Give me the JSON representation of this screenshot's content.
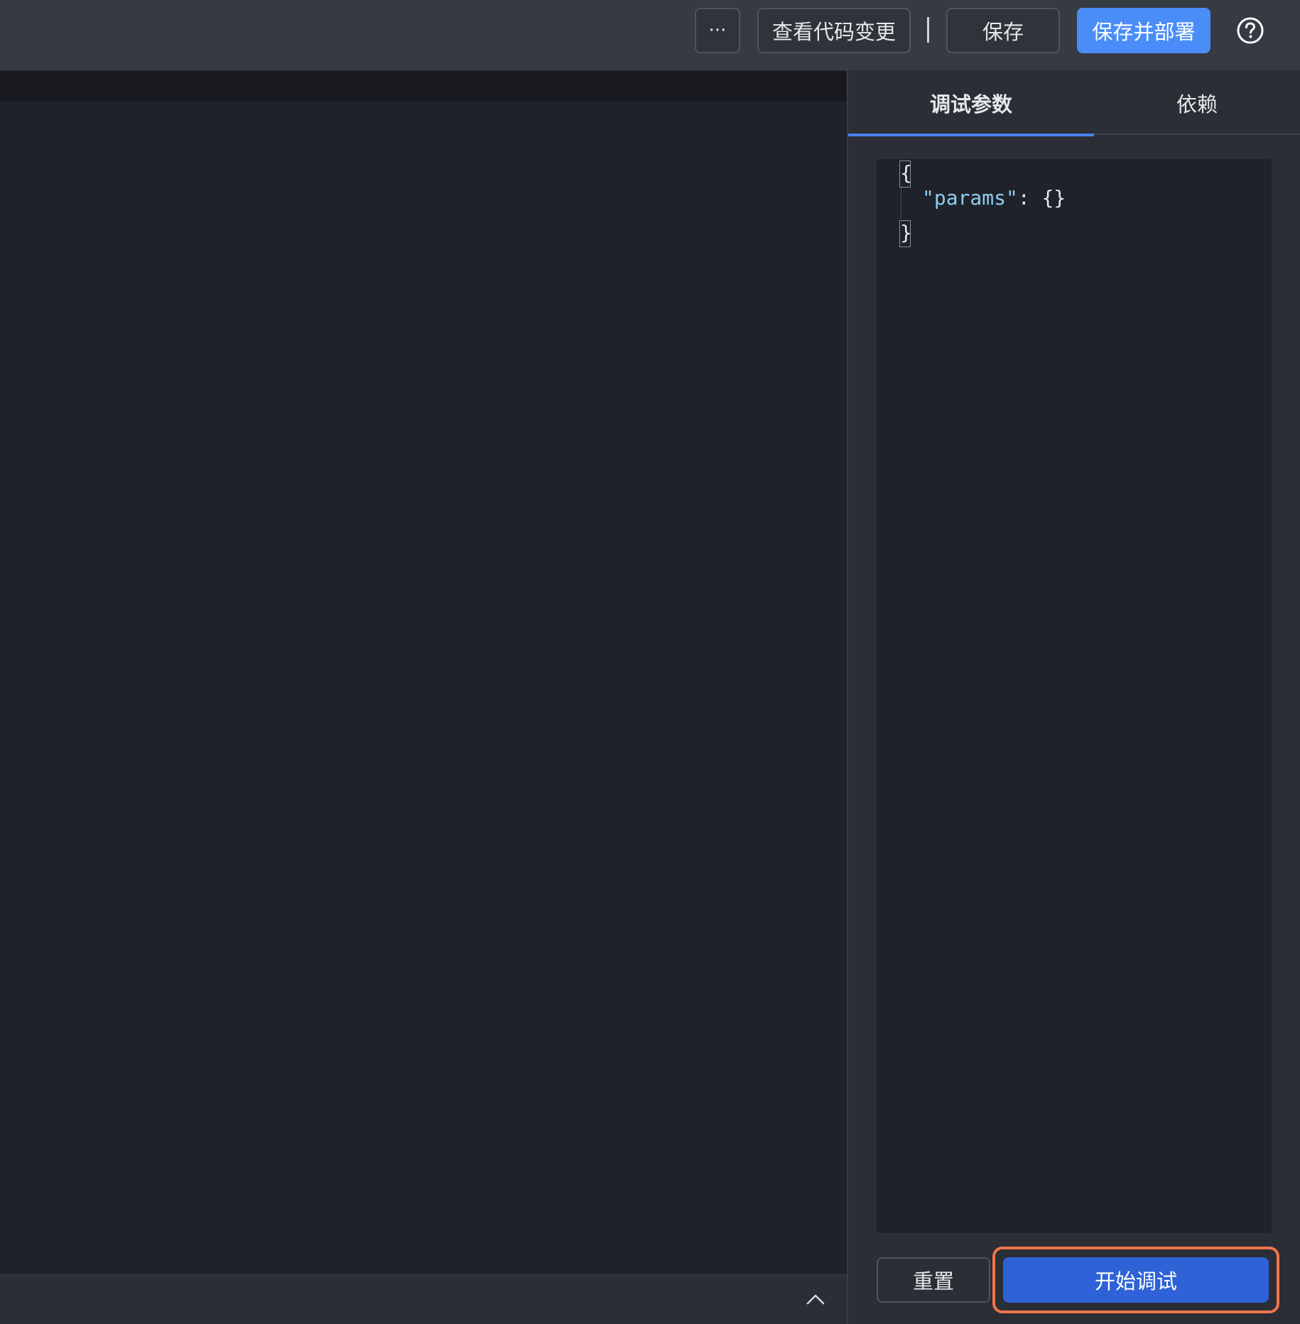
{
  "toolbar": {
    "more_label": "···",
    "view_changes_label": "查看代码变更",
    "save_label": "保存",
    "save_deploy_label": "保存并部署",
    "accent_color": "#4a8df8"
  },
  "panel": {
    "tabs": [
      {
        "label": "调试参数",
        "active": true
      },
      {
        "label": "依赖",
        "active": false
      }
    ],
    "code": {
      "open_brace": "{",
      "key": "\"params\"",
      "separator": ": ",
      "value": "{}",
      "close_brace": "}"
    },
    "reset_label": "重置",
    "start_debug_label": "开始调试"
  },
  "icons": {
    "help": "help-circle-icon",
    "collapse": "chevron-up-icon"
  }
}
